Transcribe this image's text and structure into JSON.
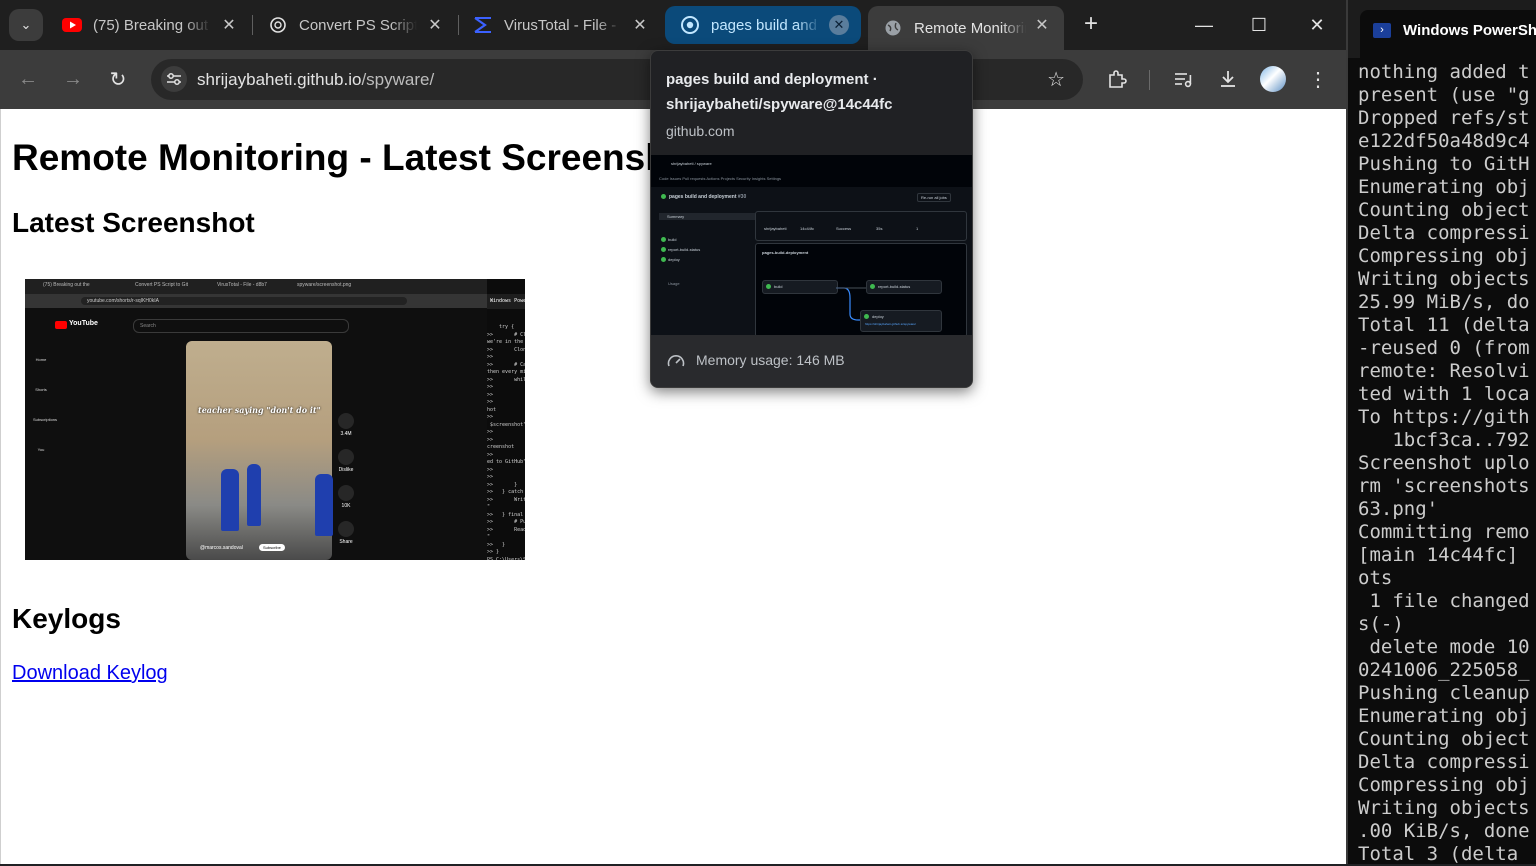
{
  "browser": {
    "tabs": [
      {
        "title": "(75) Breaking out",
        "icon": "youtube-icon"
      },
      {
        "title": "Convert PS Script",
        "icon": "chatgpt-icon"
      },
      {
        "title": "VirusTotal - File -",
        "icon": "virustotal-icon"
      },
      {
        "title": "pages build and d",
        "icon": "github-icon"
      },
      {
        "title": "Remote Monitorin",
        "icon": "globe-icon"
      }
    ],
    "url_host": "shrijaybaheti.github.io",
    "url_path": "/spyware/"
  },
  "hovercard": {
    "title": "pages build and deployment · shrijaybaheti/spyware@14c44fc",
    "domain": "github.com",
    "memory": "Memory usage: 146 MB",
    "preview": {
      "repo": "shrijaybaheti / spyware",
      "nav": "Code  Issues  Pull requests  Actions  Projects  Security  Insights  Settings",
      "workflow": "pages build and deployment",
      "run": "#30",
      "rerun": "Re-run all jobs",
      "summary": "Summary",
      "jobs": [
        "build",
        "report-build-status",
        "deploy"
      ],
      "usage": "Usage",
      "triggered_by": "shrijaybaheti",
      "commit": "14c44fc",
      "status": "Success",
      "duration": "35s",
      "artifacts": "1",
      "deploy_job": "pages-build-deployment",
      "deploy_url": "https://shrijaybaheti.github.io/spyware/"
    }
  },
  "page": {
    "title": "Remote Monitoring - Latest Screenshot and Keylogs",
    "screenshot_heading": "Latest Screenshot",
    "keylogs_heading": "Keylogs",
    "keylog_link": "Download Keylog"
  },
  "thumbnail": {
    "tabs": [
      "(75) Breaking out the",
      "Convert PS Script to Git",
      "VirusTotal - File - d8b7",
      "spyware/screenshot.png"
    ],
    "url": "youtube.com/shorts/r-sqIKH0kIA",
    "logo_text": "YouTube",
    "search": "Search",
    "side": [
      "Home",
      "Shorts",
      "Subscriptions",
      "You"
    ],
    "caption": "teacher saying \"don't do it\"",
    "actions": [
      "3.4M",
      "Dislike",
      "10K",
      "Share"
    ],
    "channel": "@marcos.sandoval",
    "subscribe": "Subscribe",
    "ps_title": "Windows PowerShell",
    "ps_lines": "    try {\n>>       # Cl\nwe're in the c\n>>       Clon\n>>\n>>       # Ca\nthen every minu\n>>       whil\n>>\n>>\n>>\nhot\n>>\n $screenshot\"\n>>\n>>\ncreenshot\n>>\ned to GitHub\"\n>>\n>>\n>>       }\n>>   } catch\n>>       Writ\n\"\n>>   } final\n>>       # Pu\n>>       Read\n\"\n>>   }\n>> }\nPS C:\\Users\\Shr"
  },
  "powershell": {
    "title": "Windows PowerShell",
    "output": "nothing added t\npresent (use \"g\nDropped refs/st\ne122df50a48d9c4\nPushing to GitH\nEnumerating obj\nCounting object\nDelta compressi\nCompressing obj\nWriting objects\n25.99 MiB/s, do\nTotal 11 (delta\n-reused 0 (from\nremote: Resolvi\nted with 1 loca\nTo https://gith\n   1bcf3ca..792\nScreenshot uplo\nrm 'screenshots\n63.png'\nCommitting remo\n[main 14c44fc] \nots\n 1 file changed\ns(-)\n delete mode 10\n0241006_225058_\nPushing cleanup\nEnumerating obj\nCounting object\nDelta compressi\nCompressing obj\nWriting objects\n.00 KiB/s, done\nTotal 3 (delta "
  }
}
